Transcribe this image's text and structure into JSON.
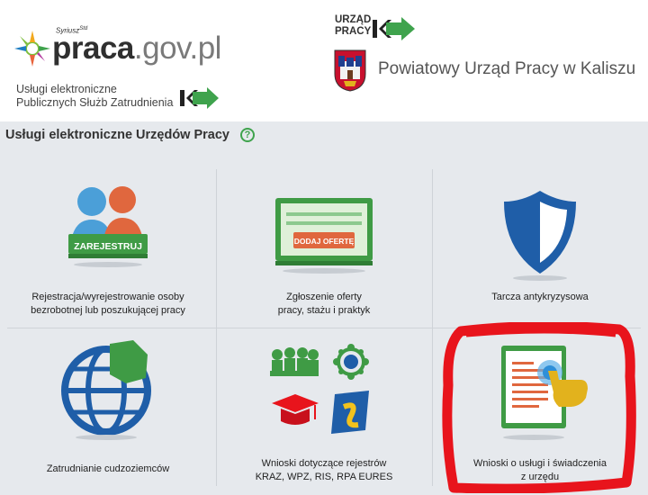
{
  "header": {
    "brand": {
      "name": "praca",
      "domain": ".gov.pl",
      "tag": "Syriusz",
      "tag_sup": "Std"
    },
    "psz_lines": [
      "Usługi elektroniczne",
      "Publicznych Służb Zatrudnienia"
    ],
    "up_lines": [
      "URZĄD",
      "PRACY"
    ],
    "office_title": "Powiatowy Urząd Pracy w Kaliszu"
  },
  "section": {
    "title": "Usługi elektroniczne Urzędów Pracy",
    "help_icon": "?"
  },
  "tiles": [
    {
      "icon": "register-people-icon",
      "badge": "ZAREJESTRUJ",
      "lines": [
        "Rejestracja/wyrejestrowanie osoby",
        "bezrobotnej lub poszukującej pracy"
      ]
    },
    {
      "icon": "job-offer-icon",
      "badge": "DODAJ OFERTĘ",
      "lines": [
        "Zgłoszenie oferty",
        "pracy, stażu i praktyk"
      ]
    },
    {
      "icon": "shield-icon",
      "lines": [
        "Tarcza antykryzysowa"
      ]
    },
    {
      "icon": "globe-icon",
      "lines": [
        "Zatrudnianie cudzoziemców"
      ]
    },
    {
      "icon": "registers-icon",
      "eures": "EURES",
      "lines": [
        "Wnioski dotyczące rejestrów",
        "KRAZ, WPZ, RIS, RPA EURES"
      ]
    },
    {
      "icon": "application-form-icon",
      "lines": [
        "Wnioski o usługi i świadczenia",
        "z urzędu"
      ]
    }
  ],
  "colors": {
    "brand_green": "#3fa34d",
    "accent_orange": "#e8643c",
    "accent_blue": "#1f5ea8",
    "highlight_red": "#e8141c"
  }
}
